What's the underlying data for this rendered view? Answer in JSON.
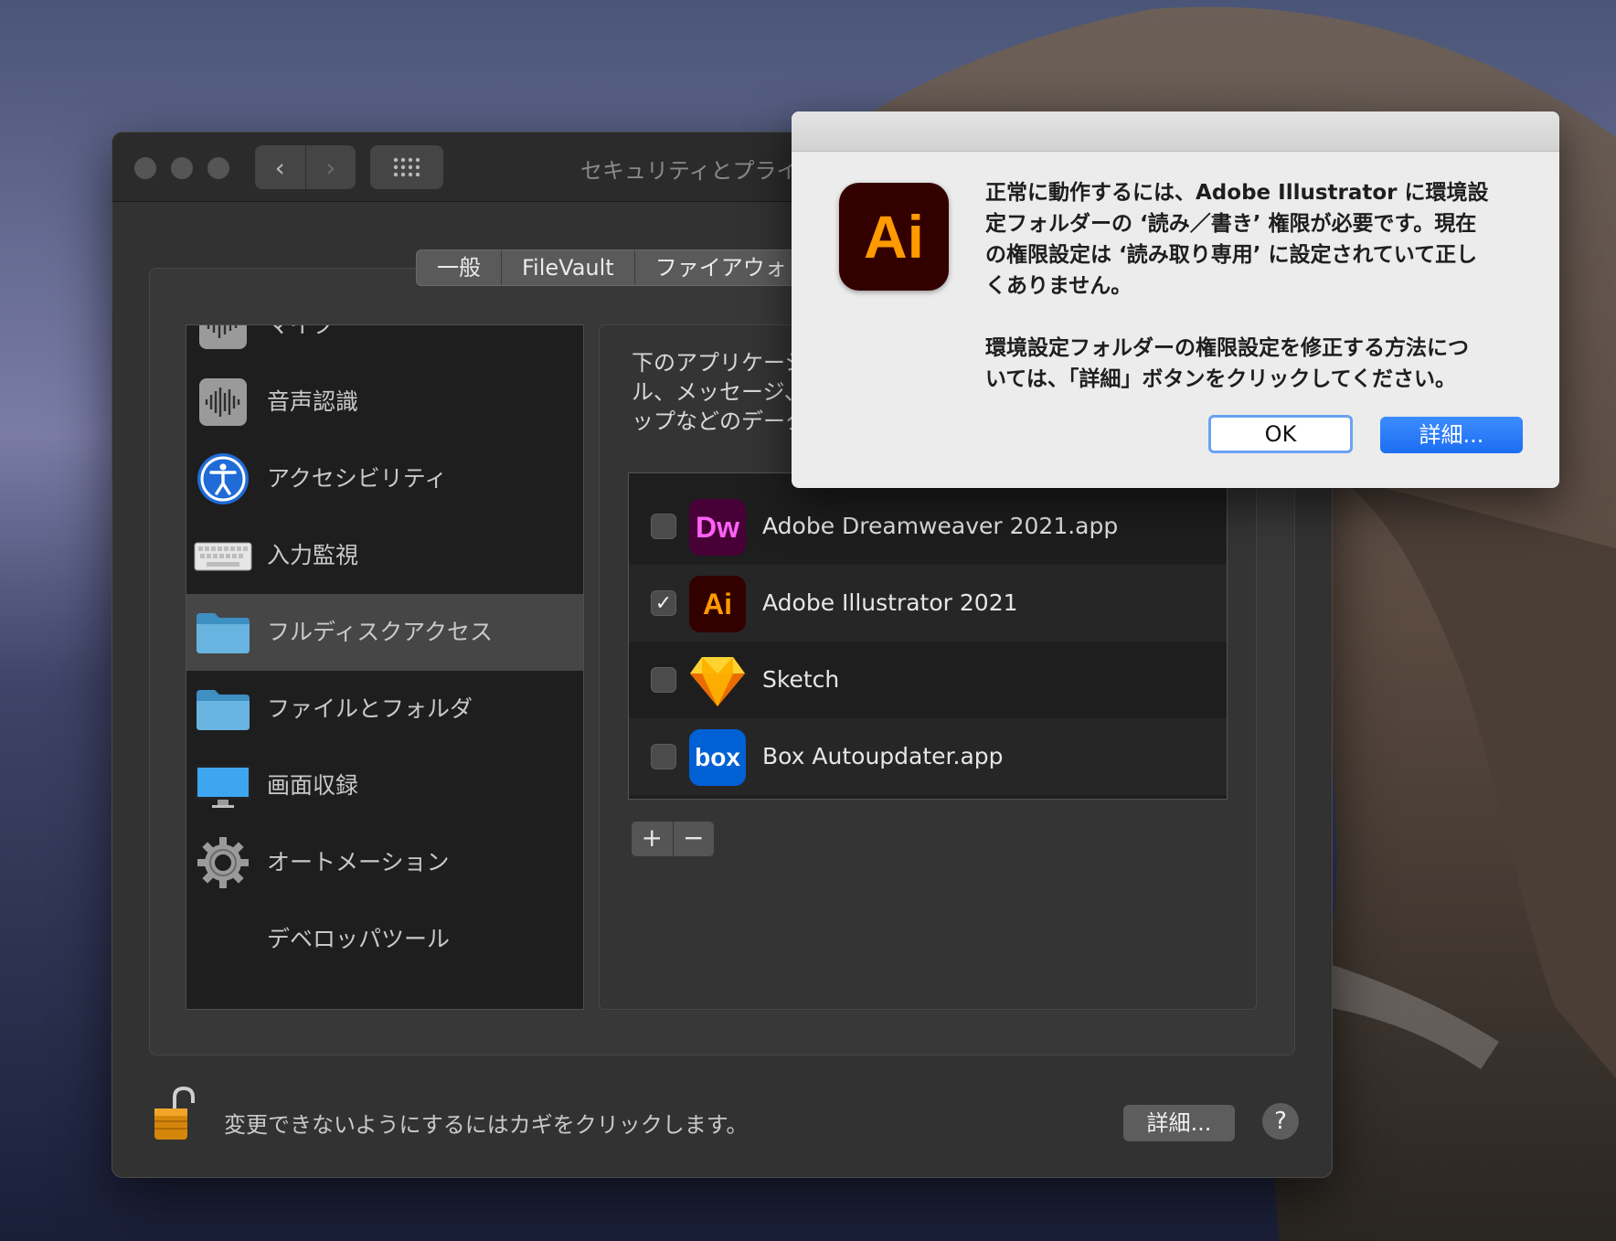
{
  "window": {
    "title": "セキュリティとプライ",
    "nav_back": "‹",
    "nav_forward": "›"
  },
  "tabs": [
    {
      "label": "一般"
    },
    {
      "label": "FileVault"
    },
    {
      "label": "ファイアウォ"
    }
  ],
  "categories": [
    {
      "label": "マイク",
      "icon": "microphone-icon"
    },
    {
      "label": "音声認識",
      "icon": "speech-recognition-icon"
    },
    {
      "label": "アクセシビリティ",
      "icon": "accessibility-icon"
    },
    {
      "label": "入力監視",
      "icon": "keyboard-icon"
    },
    {
      "label": "フルディスクアクセス",
      "icon": "folder-icon",
      "selected": true
    },
    {
      "label": "ファイルとフォルダ",
      "icon": "folder-icon"
    },
    {
      "label": "画面収録",
      "icon": "display-icon"
    },
    {
      "label": "オートメーション",
      "icon": "gear-icon"
    },
    {
      "label": "デベロッパツール",
      "icon": "none"
    }
  ],
  "description": "下のアプリケーシ\nル、メッセージ、\nップなどのデータ",
  "apps": [
    {
      "name": "Adobe Dreamweaver 2021.app",
      "checked": false,
      "icon_text": "Dw",
      "icon": "dreamweaver-icon"
    },
    {
      "name": "Adobe Illustrator 2021",
      "checked": true,
      "icon_text": "Ai",
      "icon": "illustrator-icon"
    },
    {
      "name": "Sketch",
      "checked": false,
      "icon_text": "",
      "icon": "sketch-diamond-icon"
    },
    {
      "name": "Box Autoupdater.app",
      "checked": false,
      "icon_text": "box",
      "icon": "box-icon"
    }
  ],
  "checkmark": "✓",
  "add_button": "+",
  "remove_button": "−",
  "lock_text": "変更できないようにするにはカギをクリックします。",
  "advanced_button": "詳細...",
  "help_button": "?",
  "alert": {
    "icon_text": "Ai",
    "message": "正常に動作するには、Adobe Illustrator に環境設\n定フォルダーの ‘読み／書き’ 権限が必要です。現在\nの権限設定は ‘読み取り専用’ に設定されていて正し\nくありません。\n\n環境設定フォルダーの権限設定を修正する方法につ\nいては、「詳細」ボタンをクリックしてください。",
    "ok_button": "OK",
    "detail_button": "詳細..."
  },
  "colors": {
    "illustrator_orange": "#ff9a00",
    "illustrator_bg": "#330000",
    "dreamweaver_pink": "#ff61f6",
    "box_blue": "#0061d5",
    "accent_blue": "#1c6ef2"
  }
}
